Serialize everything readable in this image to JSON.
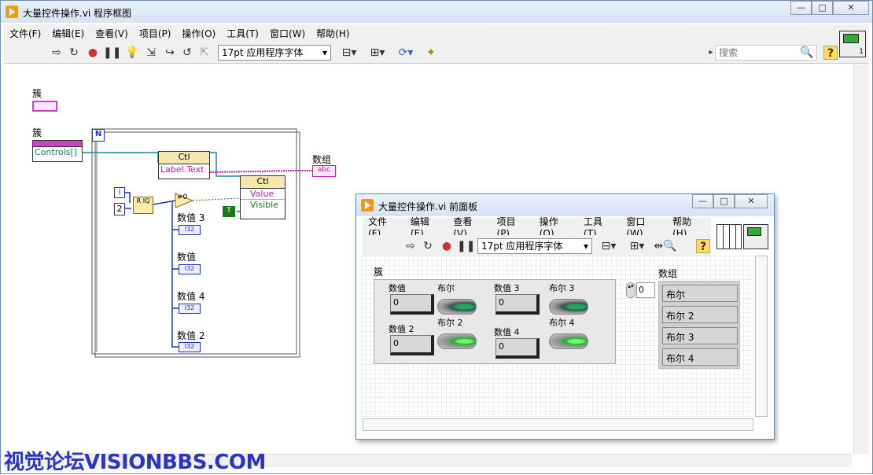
{
  "bd": {
    "title": "大量控件操作.vi 程序框图",
    "menu": [
      "文件(F)",
      "编辑(E)",
      "查看(V)",
      "项目(P)",
      "操作(O)",
      "工具(T)",
      "窗口(W)",
      "帮助(H)"
    ],
    "font": "17pt 应用程序字体",
    "search": "搜索",
    "labels": {
      "cluster_top": "簇",
      "cluster_ref": "簇",
      "controls": "Controls[]",
      "N": "N",
      "ctl1": "Ctl",
      "labeltext": "Label.Text",
      "ctl2": "Ctl",
      "value": "Value",
      "visible": "Visible",
      "i": "i",
      "two": "2",
      "rq": "R IQ",
      "ne0": "≠0",
      "n3": "数值 3",
      "n": "数值",
      "n4": "数值 4",
      "n2": "数值 2",
      "i32": "I32",
      "arr": "数组",
      "abc": "abc",
      "t": "T"
    }
  },
  "fp": {
    "title": "大量控件操作.vi 前面板",
    "menu": [
      "文件(F)",
      "编辑(E)",
      "查看(V)",
      "项目(P)",
      "操作(O)",
      "工具(T)",
      "窗口(W)",
      "帮助(H)"
    ],
    "font": "17pt 应用程序字体",
    "cluster_label": "簇",
    "numerics": [
      {
        "label": "数值",
        "value": "0"
      },
      {
        "label": "数值 2",
        "value": "0"
      },
      {
        "label": "数值 3",
        "value": "0"
      },
      {
        "label": "数值 4",
        "value": "0"
      }
    ],
    "booleans": [
      "布尔",
      "布尔 2",
      "布尔 3",
      "布尔 4"
    ],
    "array_label": "数组",
    "index": "0",
    "array": [
      "布尔",
      "布尔 2",
      "布尔 3",
      "布尔 4"
    ]
  },
  "watermark": "视觉论坛VISIONBBS.COM"
}
